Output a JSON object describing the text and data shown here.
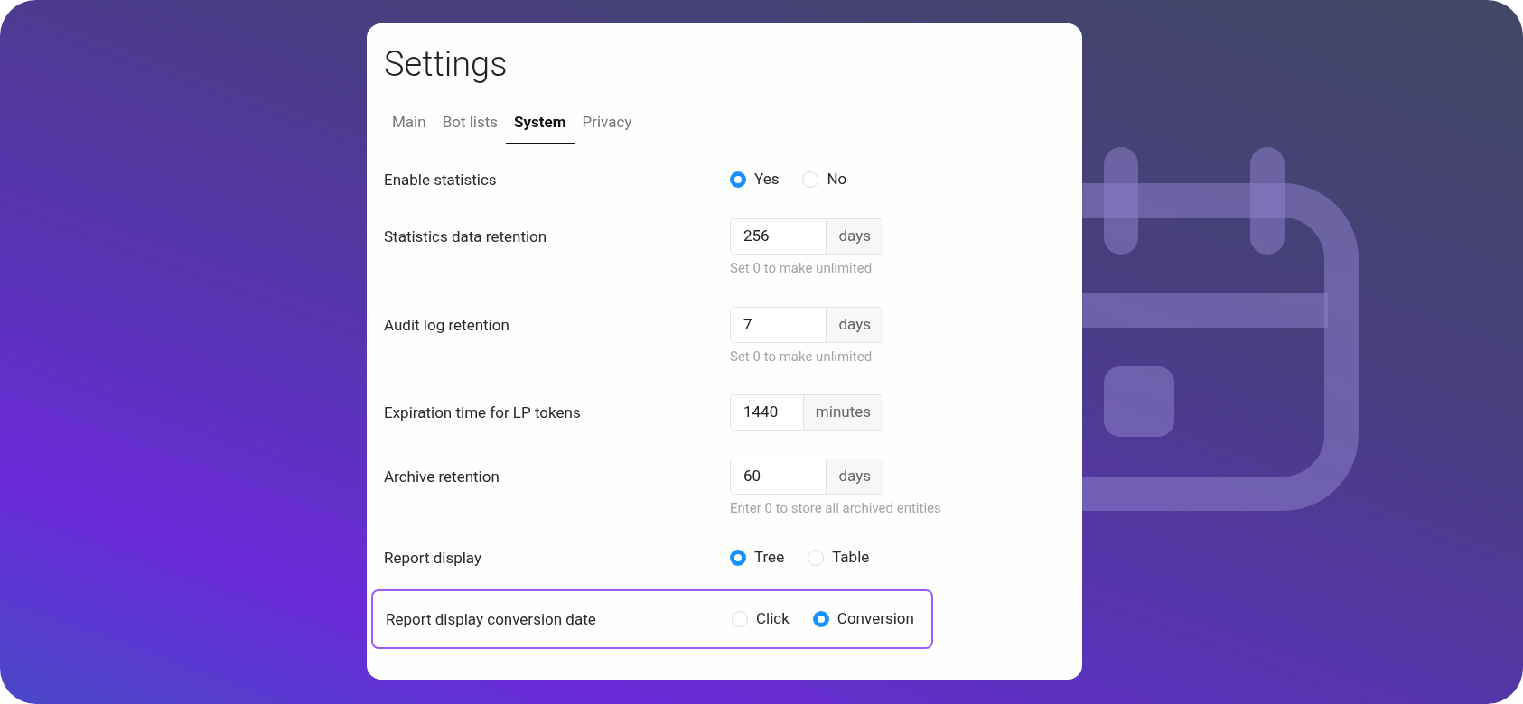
{
  "title": "Settings",
  "tabs": [
    {
      "label": "Main",
      "selected": false
    },
    {
      "label": "Bot lists",
      "selected": false
    },
    {
      "label": "System",
      "selected": true
    },
    {
      "label": "Privacy",
      "selected": false
    }
  ],
  "rows": [
    {
      "kind": "radio",
      "label": "Enable statistics",
      "highlighted": false,
      "options": [
        {
          "label": "Yes",
          "selected": true
        },
        {
          "label": "No",
          "selected": false
        }
      ]
    },
    {
      "kind": "number",
      "label": "Statistics data retention",
      "highlighted": false,
      "value": "256",
      "unit": "days",
      "hint": "Set 0 to make unlimited"
    },
    {
      "kind": "number",
      "label": "Audit log retention",
      "highlighted": false,
      "value": "7",
      "unit": "days",
      "hint": "Set 0 to make unlimited"
    },
    {
      "kind": "number",
      "label": "Expiration time for LP tokens",
      "highlighted": false,
      "value": "1440",
      "unit": "minutes"
    },
    {
      "kind": "number",
      "label": "Archive retention",
      "highlighted": false,
      "value": "60",
      "unit": "days",
      "hint": "Enter 0 to store all archived entities"
    },
    {
      "kind": "radio",
      "label": "Report display",
      "highlighted": false,
      "options": [
        {
          "label": "Tree",
          "selected": true
        },
        {
          "label": "Table",
          "selected": false
        }
      ]
    },
    {
      "kind": "radio",
      "label": "Report display conversion date",
      "highlighted": true,
      "options": [
        {
          "label": "Click",
          "selected": false
        },
        {
          "label": "Conversion",
          "selected": true
        }
      ]
    }
  ]
}
